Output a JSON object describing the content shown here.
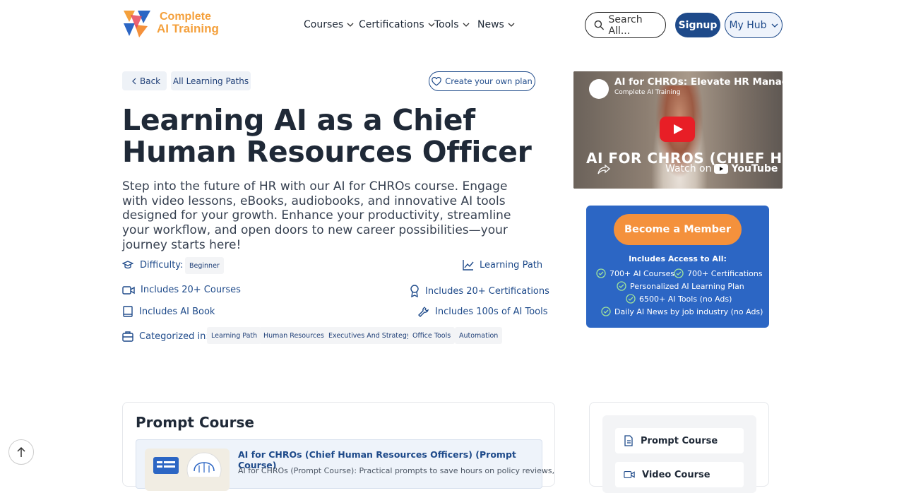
{
  "header": {
    "logo_line1": "Complete",
    "logo_line2": "AI Training",
    "nav": [
      "Courses",
      "Certifications",
      "Tools",
      "News"
    ],
    "search_placeholder": "Search All...",
    "signup": "Signup",
    "my_hub": "My Hub"
  },
  "breadcrumb": {
    "back": "Back",
    "all_paths": "All Learning Paths",
    "create_plan": "Create your own plan"
  },
  "page": {
    "title": "Learning AI as a Chief Human Resources Officer",
    "description": "Step into the future of HR with our AI for CHROs course. Engage with video lessons, eBooks, audiobooks, and innovative AI tools designed for your growth. Enhance your productivity, streamline your workflow, and open doors to new career possibilities—your journey starts here!"
  },
  "features": {
    "difficulty_label": "Difficulty:",
    "difficulty_value": "Beginner",
    "learning_path": "Learning Path",
    "courses": "Includes 20+ Courses",
    "certifications": "Includes 20+ Certifications",
    "book": "Includes AI Book",
    "tools": "Includes 100s of AI Tools",
    "categorized_label": "Categorized in:",
    "tags": [
      "Learning Path",
      "Human Resources",
      "Executives And Strategy",
      "Office Tools",
      "Automation"
    ]
  },
  "video": {
    "title": "AI for CHROs: Elevate HR Managem",
    "channel": "Complete AI Training",
    "overlay": "AI FOR CHROS (CHIEF HUMAN RESOURC",
    "watch_on": "Watch on",
    "youtube": "YouTube"
  },
  "membership": {
    "button": "Become a Member",
    "includes": "Includes Access to All:",
    "items": [
      "700+ AI Courses",
      "700+ Certifications",
      "Personalized AI Learning Plan",
      "6500+ AI Tools (no Ads)",
      "Daily AI News by job industry (no Ads)"
    ]
  },
  "prompt_section": {
    "heading": "Prompt Course",
    "course_title": "AI for CHROs (Chief Human Resources Officers) (Prompt Course)",
    "course_desc": "AI for CHROs (Prompt Course): Practical prompts to save hours on policy reviews,"
  },
  "sidebar_menu": [
    "Prompt Course",
    "Video Course"
  ],
  "colors": {
    "primary": "#1e4a8a",
    "accent": "#f4913c",
    "member_bg": "#2c66c4"
  }
}
